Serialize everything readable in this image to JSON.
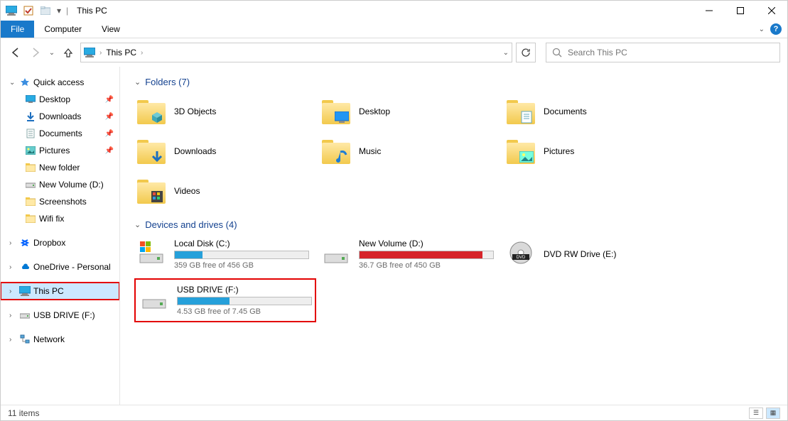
{
  "window": {
    "title": "This PC"
  },
  "ribbon": {
    "file": "File",
    "tabs": [
      "Computer",
      "View"
    ]
  },
  "nav": {
    "breadcrumb": "This PC",
    "search_placeholder": "Search This PC"
  },
  "sidebar": {
    "quick_access": {
      "label": "Quick access"
    },
    "quick_children": [
      {
        "label": "Desktop",
        "pinned": true,
        "icon": "desktop"
      },
      {
        "label": "Downloads",
        "pinned": true,
        "icon": "downloads"
      },
      {
        "label": "Documents",
        "pinned": true,
        "icon": "documents"
      },
      {
        "label": "Pictures",
        "pinned": true,
        "icon": "pictures"
      },
      {
        "label": "New folder",
        "pinned": false,
        "icon": "folder"
      },
      {
        "label": "New Volume (D:)",
        "pinned": false,
        "icon": "drive"
      },
      {
        "label": "Screenshots",
        "pinned": false,
        "icon": "folder"
      },
      {
        "label": "Wifi fix",
        "pinned": false,
        "icon": "folder"
      }
    ],
    "dropbox": {
      "label": "Dropbox"
    },
    "onedrive": {
      "label": "OneDrive - Personal"
    },
    "thispc": {
      "label": "This PC"
    },
    "usb": {
      "label": "USB DRIVE (F:)"
    },
    "network": {
      "label": "Network"
    }
  },
  "content": {
    "folders_header": "Folders (7)",
    "folders": [
      {
        "label": "3D Objects",
        "overlay": "cube"
      },
      {
        "label": "Desktop",
        "overlay": "desktop"
      },
      {
        "label": "Documents",
        "overlay": "doc"
      },
      {
        "label": "Downloads",
        "overlay": "down"
      },
      {
        "label": "Music",
        "overlay": "music"
      },
      {
        "label": "Pictures",
        "overlay": "pic"
      },
      {
        "label": "Videos",
        "overlay": "video"
      }
    ],
    "drives_header": "Devices and drives (4)",
    "drives": [
      {
        "label": "Local Disk (C:)",
        "free_text": "359 GB free of 456 GB",
        "fill_pct": 21,
        "color": "blue",
        "icon": "windisk",
        "highlight": false
      },
      {
        "label": "New Volume (D:)",
        "free_text": "36.7 GB free of 450 GB",
        "fill_pct": 92,
        "color": "red",
        "icon": "disk",
        "highlight": false
      },
      {
        "label": "DVD RW Drive (E:)",
        "free_text": "",
        "fill_pct": 0,
        "color": "none",
        "icon": "dvd",
        "highlight": false
      },
      {
        "label": "USB DRIVE (F:)",
        "free_text": "4.53 GB free of 7.45 GB",
        "fill_pct": 39,
        "color": "blue",
        "icon": "disk",
        "highlight": true
      }
    ]
  },
  "status": {
    "items_text": "11 items"
  }
}
